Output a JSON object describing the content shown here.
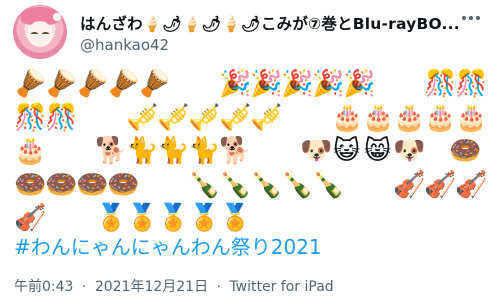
{
  "user": {
    "display_name": "はんざわ🍦🌶🍦🌶🍦🌶こみが⑦巻とBlu-rayBO...",
    "handle": "@hankao42"
  },
  "emoji_rows": [
    [
      "🪘",
      "🪘",
      "🪘",
      "🪘",
      "🪘",
      "",
      "",
      "🎉",
      "🎉",
      "🎉",
      "🎉",
      "🎉",
      "",
      "",
      "🎊",
      "🎊"
    ],
    [
      "🎊",
      "🎊",
      "",
      "",
      "🎺",
      "🎺",
      "🎺",
      "🎺",
      "🎺",
      "",
      "",
      "🎂",
      "🎂",
      "🎂",
      "🎂",
      "🎂"
    ],
    [
      "🎂",
      "",
      "",
      "🐕",
      "🐈",
      "🐈",
      "🐈",
      "🐕",
      "",
      "",
      "🐶",
      "😺",
      "😸",
      "🐶",
      "",
      "🍩"
    ],
    [
      "🍩",
      "🍩",
      "🍩",
      "🍩",
      "",
      "",
      "🍾",
      "🍾",
      "🍾",
      "🍾",
      "🍾",
      "",
      "",
      "🎻",
      "🎻",
      "🎻"
    ],
    [
      "🎻",
      "",
      "",
      "🏅",
      "🏅",
      "🏅",
      "🏅",
      "🏅"
    ]
  ],
  "hashtag": "#わんにゃんにゃんわん祭り2021",
  "meta": {
    "time": "午前0:43",
    "separator": "·",
    "date": "2021年12月21日",
    "source": "Twitter for iPad"
  }
}
